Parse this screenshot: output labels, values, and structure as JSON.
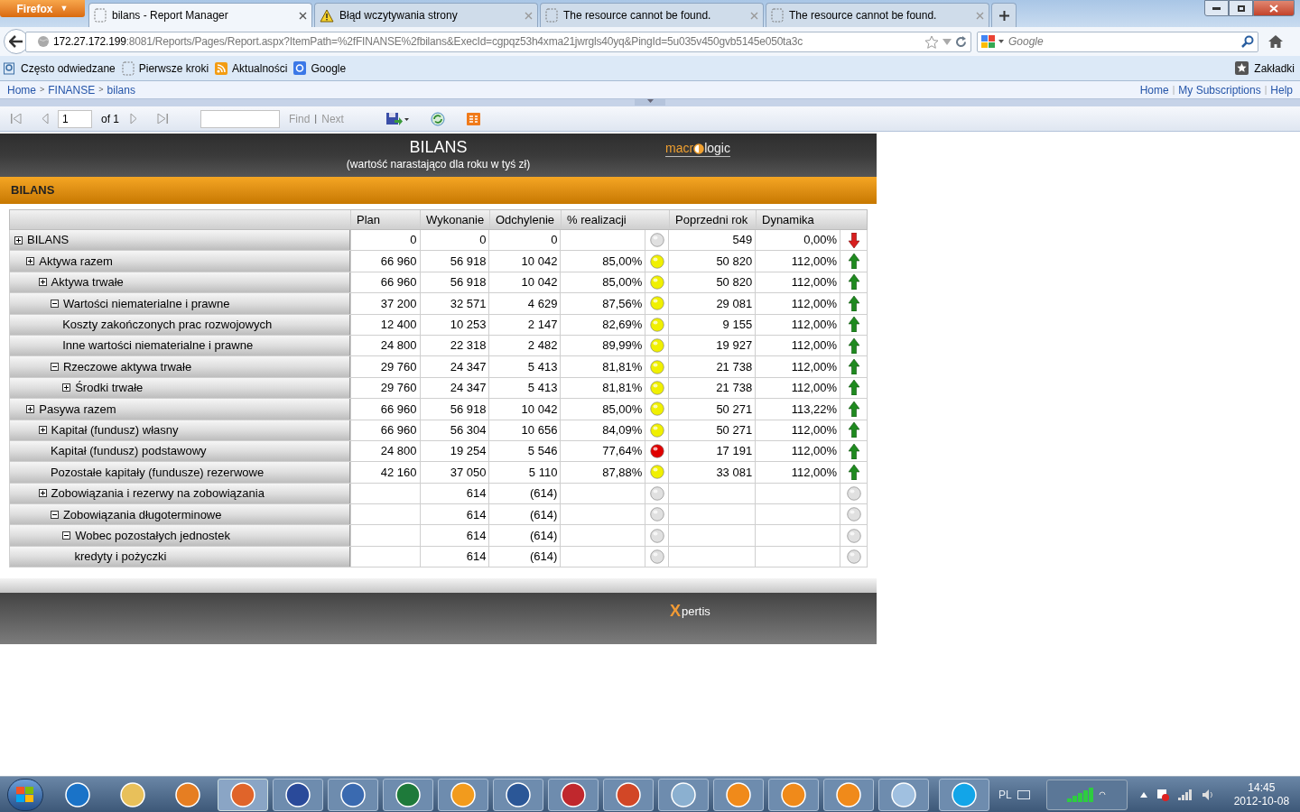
{
  "browser": {
    "menu_button": {
      "label": "Firefox",
      "caret": "▼"
    },
    "tabs": [
      {
        "title": "bilans - Report Manager",
        "kind": "page",
        "selected": true
      },
      {
        "title": "Błąd wczytywania strony",
        "kind": "warning",
        "selected": false
      },
      {
        "title": "The resource cannot be found.",
        "kind": "page",
        "selected": false
      },
      {
        "title": "The resource cannot be found.",
        "kind": "page",
        "selected": false
      }
    ],
    "url_host": "172.27.172.199",
    "url_rest": ":8081/Reports/Pages/Report.aspx?ItemPath=%2fFINANSE%2fbilans&ExecId=cgpqz53h4xma21jwrgls40yq&PingId=5u035v450gvb5145e050ta3c",
    "search": {
      "placeholder": "Google"
    },
    "bookmarks": [
      {
        "label": "Często odwiedzane",
        "kind": "search"
      },
      {
        "label": "Pierwsze kroki",
        "kind": "page"
      },
      {
        "label": "Aktualności",
        "kind": "rss"
      },
      {
        "label": "Google",
        "kind": "google"
      }
    ],
    "bookmarks_menu": "Zakładki"
  },
  "breadcrumb": [
    {
      "kind": "link",
      "text": "Home"
    },
    {
      "kind": "separator",
      "text": ">"
    },
    {
      "kind": "link",
      "text": "FINANSE"
    },
    {
      "kind": "separator",
      "text": ">"
    },
    {
      "kind": "link",
      "text": "bilans"
    }
  ],
  "top_links": [
    {
      "kind": "link",
      "text": "Home"
    },
    {
      "kind": "separator",
      "text": "|"
    },
    {
      "kind": "link",
      "text": "My Subscriptions"
    },
    {
      "kind": "separator",
      "text": "|"
    },
    {
      "kind": "link",
      "text": "Help"
    }
  ],
  "report_toolbar": {
    "page": "1",
    "of": "of 1",
    "find": [
      {
        "kind": "link",
        "text": "Find"
      },
      {
        "kind": "separator",
        "text": "|"
      },
      {
        "kind": "link",
        "text": "Next"
      }
    ]
  },
  "report": {
    "title": "BILANS",
    "subtitle": "(wartość narastająco dla roku w tyś zł)",
    "logo_left": "macr",
    "logo_right": "logic",
    "section": "BILANS",
    "columns": [
      "Plan",
      "Wykonanie",
      "Odchylenie",
      "% realizacji",
      "Poprzedni rok",
      "Dynamika"
    ],
    "rows": [
      {
        "label": "BILANS",
        "expanded": false,
        "plan": "0",
        "wykonanie": "0",
        "odchylenie": "0",
        "light": {
          "color": "#e0e0e0"
        },
        "poprzedni": "549",
        "dynamika": "0,00%",
        "trend": {
          "kind": "down"
        },
        "children": [
          {
            "label": "Aktywa razem",
            "expanded": false,
            "plan": "66 960",
            "wykonanie": "56 918",
            "odchylenie": "10 042",
            "realizacja": "85,00%",
            "light": {
              "color": "#f0f000"
            },
            "poprzedni": "50 820",
            "dynamika": "112,00%",
            "trend": {
              "kind": "up"
            },
            "children": [
              {
                "label": "Aktywa trwałe",
                "expanded": false,
                "plan": "66 960",
                "wykonanie": "56 918",
                "odchylenie": "10 042",
                "realizacja": "85,00%",
                "light": {
                  "color": "#f0f000"
                },
                "poprzedni": "50 820",
                "dynamika": "112,00%",
                "trend": {
                  "kind": "up"
                },
                "children": [
                  {
                    "label": "Wartości niematerialne i prawne",
                    "expanded": true,
                    "plan": "37 200",
                    "wykonanie": "32 571",
                    "odchylenie": "4 629",
                    "realizacja": "87,56%",
                    "light": {
                      "color": "#f0f000"
                    },
                    "poprzedni": "29 081",
                    "dynamika": "112,00%",
                    "trend": {
                      "kind": "up"
                    },
                    "children": [
                      {
                        "label": "Koszty zakończonych prac rozwojowych",
                        "plan": "12 400",
                        "wykonanie": "10 253",
                        "odchylenie": "2 147",
                        "realizacja": "82,69%",
                        "light": {
                          "color": "#f0f000"
                        },
                        "poprzedni": "9 155",
                        "dynamika": "112,00%",
                        "trend": {
                          "kind": "up"
                        }
                      },
                      {
                        "label": "Inne wartości niematerialne i prawne",
                        "plan": "24 800",
                        "wykonanie": "22 318",
                        "odchylenie": "2 482",
                        "realizacja": "89,99%",
                        "light": {
                          "color": "#f0f000"
                        },
                        "poprzedni": "19 927",
                        "dynamika": "112,00%",
                        "trend": {
                          "kind": "up"
                        }
                      }
                    ]
                  },
                  {
                    "label": "Rzeczowe aktywa trwałe",
                    "expanded": true,
                    "plan": "29 760",
                    "wykonanie": "24 347",
                    "odchylenie": "5 413",
                    "realizacja": "81,81%",
                    "light": {
                      "color": "#f0f000"
                    },
                    "poprzedni": "21 738",
                    "dynamika": "112,00%",
                    "trend": {
                      "kind": "up"
                    },
                    "children": [
                      {
                        "label": "Środki trwałe",
                        "expanded": false,
                        "plan": "29 760",
                        "wykonanie": "24 347",
                        "odchylenie": "5 413",
                        "realizacja": "81,81%",
                        "light": {
                          "color": "#f0f000"
                        },
                        "poprzedni": "21 738",
                        "dynamika": "112,00%",
                        "trend": {
                          "kind": "up"
                        }
                      }
                    ]
                  }
                ]
              }
            ]
          },
          {
            "label": "Pasywa razem",
            "expanded": false,
            "plan": "66 960",
            "wykonanie": "56 918",
            "odchylenie": "10 042",
            "realizacja": "85,00%",
            "light": {
              "color": "#f0f000"
            },
            "poprzedni": "50 271",
            "dynamika": "113,22%",
            "trend": {
              "kind": "up"
            },
            "children": [
              {
                "label": "Kapitał (fundusz) własny",
                "expanded": false,
                "plan": "66 960",
                "wykonanie": "56 304",
                "odchylenie": "10 656",
                "realizacja": "84,09%",
                "light": {
                  "color": "#f0f000"
                },
                "poprzedni": "50 271",
                "dynamika": "112,00%",
                "trend": {
                  "kind": "up"
                },
                "children": [
                  {
                    "label": "Kapitał (fundusz) podstawowy",
                    "plan": "24 800",
                    "wykonanie": "19 254",
                    "odchylenie": "5 546",
                    "realizacja": "77,64%",
                    "light": {
                      "color": "#e00000"
                    },
                    "poprzedni": "17 191",
                    "dynamika": "112,00%",
                    "trend": {
                      "kind": "up"
                    }
                  },
                  {
                    "label": "Pozostałe kapitały (fundusze) rezerwowe",
                    "plan": "42 160",
                    "wykonanie": "37 050",
                    "odchylenie": "5 110",
                    "realizacja": "87,88%",
                    "light": {
                      "color": "#f0f000"
                    },
                    "poprzedni": "33 081",
                    "dynamika": "112,00%",
                    "trend": {
                      "kind": "up"
                    }
                  }
                ]
              },
              {
                "label": "Zobowiązania i rezerwy na zobowiązania",
                "expanded": false,
                "wykonanie": "614",
                "odchylenie": "(614)",
                "light": {
                  "color": "#e0e0e0"
                },
                "trend": {
                  "kind": "none"
                },
                "children": [
                  {
                    "label": "Zobowiązania długoterminowe",
                    "expanded": true,
                    "wykonanie": "614",
                    "odchylenie": "(614)",
                    "light": {
                      "color": "#e0e0e0"
                    },
                    "trend": {
                      "kind": "none"
                    },
                    "children": [
                      {
                        "label": "Wobec pozostałych jednostek",
                        "expanded": true,
                        "wykonanie": "614",
                        "odchylenie": "(614)",
                        "light": {
                          "color": "#e0e0e0"
                        },
                        "trend": {
                          "kind": "none"
                        },
                        "children": [
                          {
                            "label": "kredyty i pożyczki",
                            "wykonanie": "614",
                            "odchylenie": "(614)",
                            "light": {
                              "color": "#e0e0e0"
                            },
                            "trend": {
                              "kind": "none"
                            }
                          }
                        ]
                      }
                    ]
                  }
                ]
              }
            ]
          }
        ]
      }
    ],
    "footer_logo_left": "X",
    "footer_logo_right": "pertis"
  },
  "taskbar": {
    "language": "PL",
    "time": "14:45",
    "date": "2012-10-08"
  }
}
